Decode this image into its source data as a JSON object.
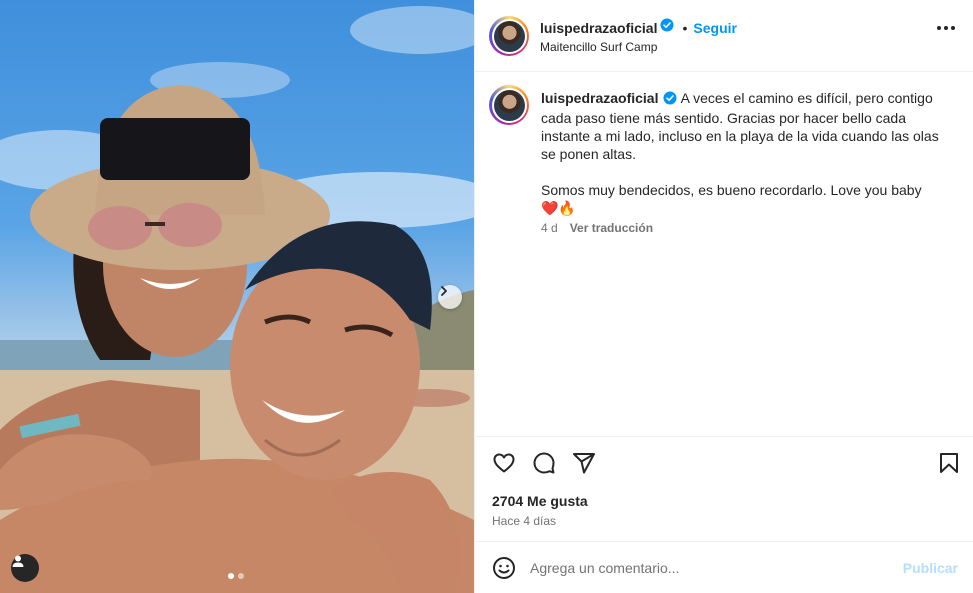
{
  "post": {
    "username": "luispedrazaoficial",
    "separator": "•",
    "follow_label": "Seguir",
    "location": "Maitencillo Surf Camp",
    "caption_line1": "A veces el camino es difícil, pero contigo cada paso tiene más sentido. Gracias por hacer bello cada instante a mi lado, incluso en la playa de la vida cuando las olas se ponen altas.",
    "caption_line2": "Somos muy bendecidos, es bueno recordarlo. Love you baby",
    "caption_emojis": "❤️🔥",
    "caption_age": "4 d",
    "translate_label": "Ver traducción",
    "likes": "2704 Me gusta",
    "posted_ago": "Hace 4 días"
  },
  "comment": {
    "placeholder": "Agrega un comentario...",
    "publish_label": "Publicar"
  },
  "carousel": {
    "current": 1,
    "total": 2
  },
  "colors": {
    "accent": "#0095f6",
    "publish_disabled": "#b2dffc",
    "text": "#262626",
    "muted": "#737373"
  },
  "icons": {
    "verified": "verified-badge-icon",
    "more": "more-options-icon",
    "like": "heart-icon",
    "comment": "comment-icon",
    "share": "share-icon",
    "save": "bookmark-icon",
    "emoji": "emoji-icon",
    "next": "chevron-right-icon",
    "tagged": "user-tag-icon"
  }
}
